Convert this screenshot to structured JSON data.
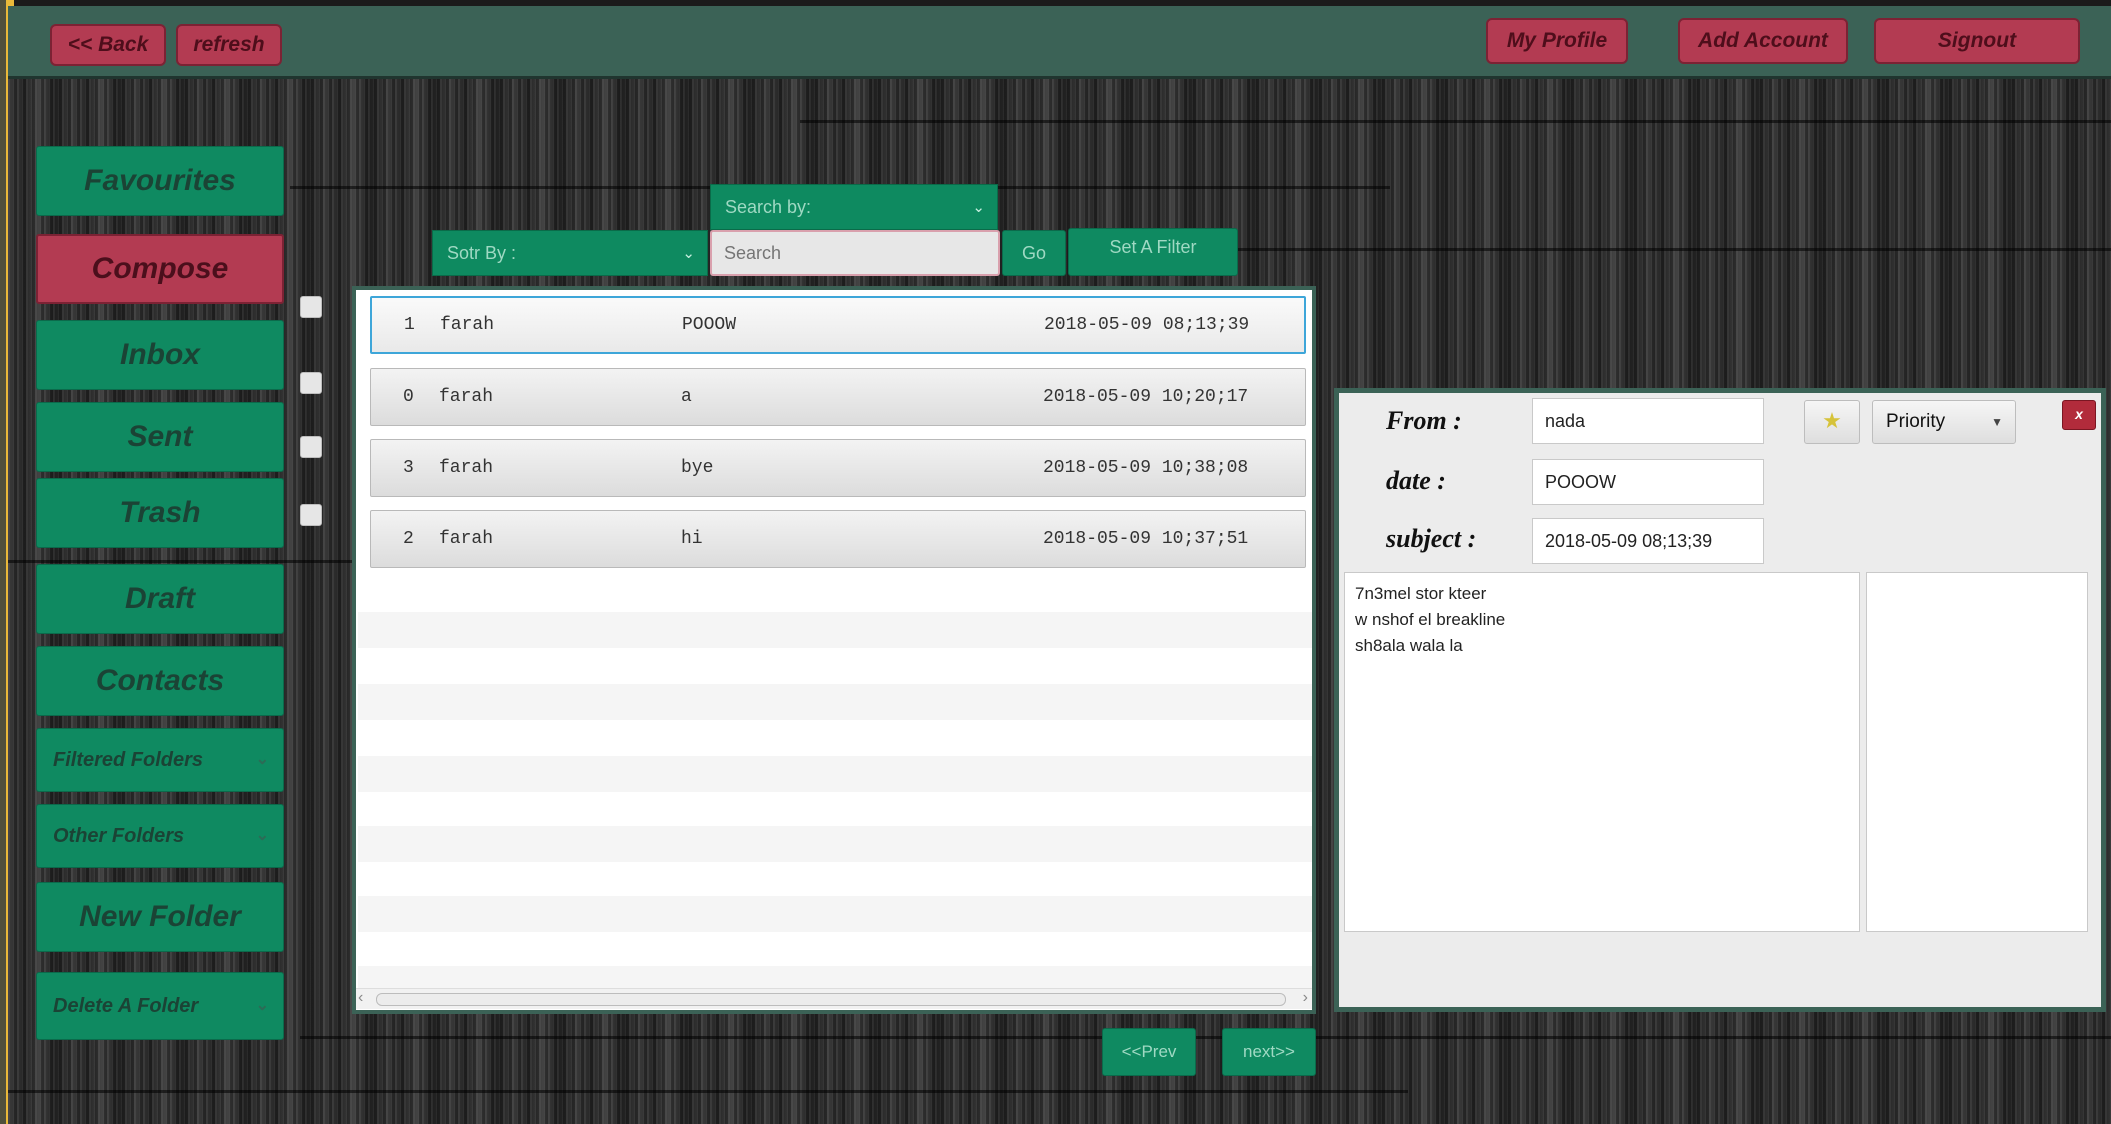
{
  "topbar": {
    "back_label": "<< Back",
    "refresh_label": "refresh",
    "profile_label": "My Profile",
    "add_account_label": "Add Account",
    "signout_label": "Signout"
  },
  "sidebar": {
    "items": [
      {
        "label": "Favourites"
      },
      {
        "label": "Compose"
      },
      {
        "label": "Inbox"
      },
      {
        "label": "Sent"
      },
      {
        "label": "Trash"
      },
      {
        "label": "Draft"
      },
      {
        "label": "Contacts"
      },
      {
        "label": "Filtered Folders"
      },
      {
        "label": "Other Folders"
      },
      {
        "label": "New Folder"
      },
      {
        "label": "Delete A Folder"
      }
    ]
  },
  "toolbar": {
    "sort_label": "Sotr By :",
    "search_by_label": "Search by:",
    "search_placeholder": "Search",
    "go_label": "Go",
    "filter_label": "Set A Filter"
  },
  "messages": [
    {
      "id": "1",
      "from": "farah",
      "subject": "POOOW",
      "date": "2018-05-09 08;13;39"
    },
    {
      "id": "0",
      "from": "farah",
      "subject": "a",
      "date": "2018-05-09 10;20;17"
    },
    {
      "id": "3",
      "from": "farah",
      "subject": "bye",
      "date": "2018-05-09 10;38;08"
    },
    {
      "id": "2",
      "from": "farah",
      "subject": "hi",
      "date": "2018-05-09 10;37;51"
    }
  ],
  "pager": {
    "prev_label": "<<Prev",
    "next_label": "next>>"
  },
  "detail": {
    "from_label": "From :",
    "date_label": "date :",
    "subject_label": "subject :",
    "from_value": "nada",
    "date_value": "POOOW",
    "subject_value": "2018-05-09 08;13;39",
    "priority_label": "Priority",
    "close_label": "x",
    "body_lines": [
      "7n3mel stor kteer",
      "w nshof el breakline",
      "sh8ala wala la"
    ]
  },
  "colors": {
    "green": "#0f8a61",
    "red": "#b33b52",
    "topbar": "#3b6256"
  }
}
